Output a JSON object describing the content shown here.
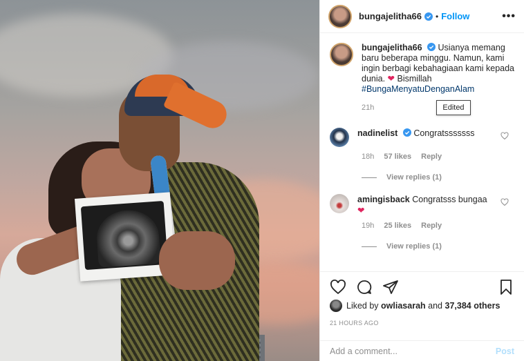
{
  "post": {
    "username": "bungajelitha66",
    "follow_label": "Follow",
    "more_label": "•••",
    "dot": "•"
  },
  "caption": {
    "username": "bungajelitha66",
    "text": "Usianya memang baru beberapa minggu. Namun, kami ingin berbagi kebahagiaan kami kepada dunia.",
    "heart": "❤",
    "after_heart": "Bismillah",
    "hashtag": "#BungaMenyatuDenganAlam",
    "time": "21h",
    "edited_label": "Edited"
  },
  "comments": [
    {
      "username": "nadinelist",
      "verified": true,
      "text": "Congratsssssss",
      "time": "18h",
      "likes": "57 likes",
      "reply": "Reply",
      "view_replies": "View replies (1)"
    },
    {
      "username": "amingisback",
      "verified": false,
      "text": "Congratsss bungaa",
      "heart": "❤",
      "time": "19h",
      "likes": "25 likes",
      "reply": "Reply",
      "view_replies": "View replies (1)"
    }
  ],
  "likes_line": {
    "prefix": "Liked by",
    "user": "owliasarah",
    "middle": "and",
    "count": "37,384 others"
  },
  "timestamp": "21 HOURS AGO",
  "add_comment": {
    "placeholder": "Add a comment...",
    "post_label": "Post"
  },
  "colors": {
    "accent": "#0095f6",
    "post_disabled": "#b2dffc",
    "heart": "#e0245e",
    "verified": "#3897f0"
  },
  "icons": [
    "verified-icon",
    "heart-icon",
    "comment-icon",
    "share-icon",
    "bookmark-icon",
    "more-icon"
  ]
}
